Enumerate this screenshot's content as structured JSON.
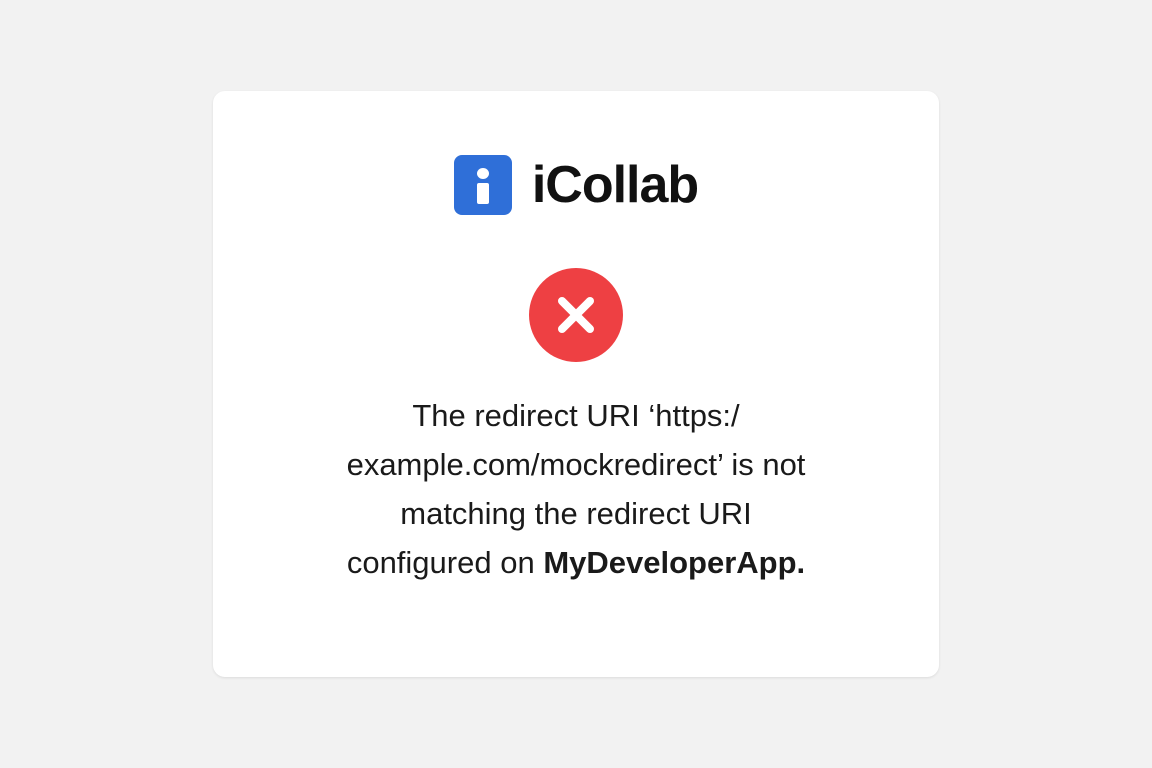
{
  "brand": {
    "name": "iCollab",
    "icon": "info-icon",
    "icon_color": "#2f6fd8"
  },
  "error": {
    "icon": "error-x-icon",
    "color": "#ee4043",
    "message_part1": "The redirect URI ‘https:/",
    "message_part2": "example.com/mockredirect’ is not",
    "message_part3": "matching the redirect URI",
    "message_part4": "configured on ",
    "app_name": "MyDeveloperApp."
  }
}
